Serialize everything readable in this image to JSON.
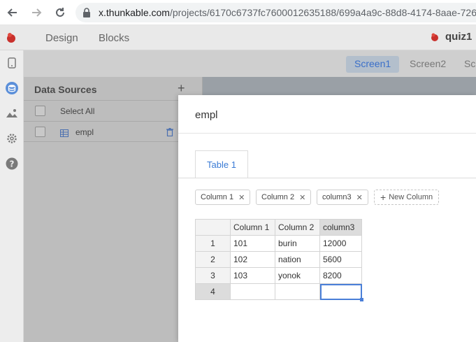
{
  "browser": {
    "url_host": "x.thunkable.com",
    "url_path": "/projects/6170c6737fc7600012635188/699a4a9c-88d8-4174-8aae-726e"
  },
  "header": {
    "tabs": [
      "Design",
      "Blocks"
    ],
    "project_name": "quiz1"
  },
  "screens": [
    "Screen1",
    "Screen2",
    "Sc"
  ],
  "data_sources": {
    "title": "Data Sources",
    "add_label": "+",
    "select_all": "Select All",
    "items": [
      {
        "name": "empl"
      }
    ]
  },
  "modal": {
    "title": "empl",
    "tabs": [
      "Table 1"
    ],
    "columns": [
      "Column 1",
      "Column 2",
      "column3"
    ],
    "new_column_label": "New Column",
    "rows": [
      {
        "num": "1",
        "cells": [
          "101",
          "burin",
          "12000"
        ]
      },
      {
        "num": "2",
        "cells": [
          "102",
          "nation",
          "5600"
        ]
      },
      {
        "num": "3",
        "cells": [
          "103",
          "yonok",
          "8200"
        ]
      },
      {
        "num": "4",
        "cells": [
          "",
          "",
          ""
        ]
      }
    ]
  },
  "colors": {
    "accent": "#3a7bd5",
    "active_screen_bg": "#b3bfcc",
    "logo_red": "#c9302c"
  },
  "icons": {
    "browser": [
      "back-arrow-icon",
      "forward-arrow-icon",
      "reload-icon",
      "lock-icon"
    ],
    "rail": [
      "phone-icon",
      "database-icon",
      "image-icon",
      "gear-icon",
      "help-icon"
    ]
  }
}
